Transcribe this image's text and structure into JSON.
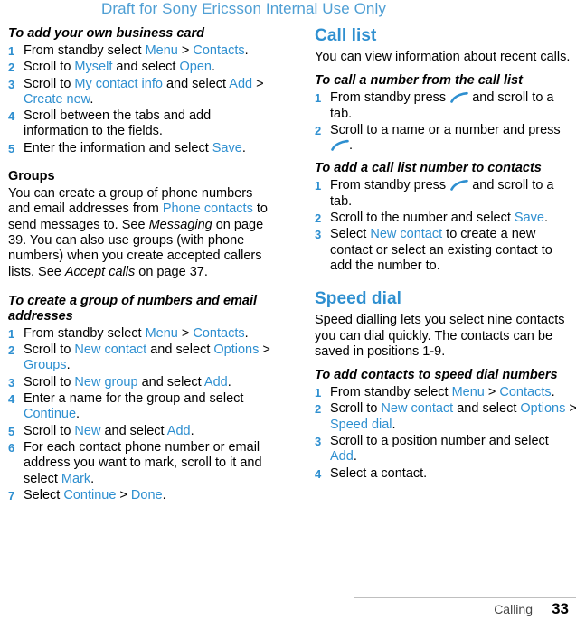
{
  "draft_notice": "Draft for Sony Ericsson Internal Use Only",
  "footer": {
    "chapter": "Calling",
    "page_number": "33"
  },
  "left_column": {
    "task1": {
      "heading": "To add your own business card",
      "steps": [
        {
          "parts": [
            {
              "t": "From standby select ",
              "s": "n"
            },
            {
              "t": "Menu",
              "s": "l"
            },
            {
              "t": " > ",
              "s": "n"
            },
            {
              "t": "Contacts",
              "s": "l"
            },
            {
              "t": ".",
              "s": "n"
            }
          ]
        },
        {
          "parts": [
            {
              "t": "Scroll to ",
              "s": "n"
            },
            {
              "t": "Myself",
              "s": "l"
            },
            {
              "t": " and select ",
              "s": "n"
            },
            {
              "t": "Open",
              "s": "l"
            },
            {
              "t": ".",
              "s": "n"
            }
          ]
        },
        {
          "parts": [
            {
              "t": "Scroll to ",
              "s": "n"
            },
            {
              "t": "My contact info",
              "s": "l"
            },
            {
              "t": " and select ",
              "s": "n"
            },
            {
              "t": "Add",
              "s": "l"
            },
            {
              "t": " > ",
              "s": "n"
            },
            {
              "t": "Create new",
              "s": "l"
            },
            {
              "t": ".",
              "s": "n"
            }
          ]
        },
        {
          "parts": [
            {
              "t": "Scroll between the tabs and add information to the fields.",
              "s": "n"
            }
          ]
        },
        {
          "parts": [
            {
              "t": "Enter the information and select ",
              "s": "n"
            },
            {
              "t": "Save",
              "s": "l"
            },
            {
              "t": ".",
              "s": "n"
            }
          ]
        }
      ]
    },
    "groups": {
      "heading": "Groups",
      "body": [
        {
          "parts": [
            {
              "t": "You can create a group of phone numbers and email addresses from ",
              "s": "n"
            },
            {
              "t": "Phone contacts",
              "s": "l"
            },
            {
              "t": " to send messages to. See ",
              "s": "n"
            },
            {
              "t": "Messaging",
              "s": "i"
            },
            {
              "t": " on page 39. You can also use groups (with phone numbers) when you create accepted callers lists. See ",
              "s": "n"
            },
            {
              "t": "Accept calls",
              "s": "i"
            },
            {
              "t": " on page 37.",
              "s": "n"
            }
          ]
        }
      ]
    },
    "task2": {
      "heading": "To create a group of numbers and email addresses",
      "steps": [
        {
          "parts": [
            {
              "t": "From standby select ",
              "s": "n"
            },
            {
              "t": "Menu",
              "s": "l"
            },
            {
              "t": " > ",
              "s": "n"
            },
            {
              "t": "Contacts",
              "s": "l"
            },
            {
              "t": ".",
              "s": "n"
            }
          ]
        },
        {
          "parts": [
            {
              "t": "Scroll to ",
              "s": "n"
            },
            {
              "t": "New contact",
              "s": "l"
            },
            {
              "t": " and select ",
              "s": "n"
            },
            {
              "t": "Options",
              "s": "l"
            },
            {
              "t": " > ",
              "s": "n"
            },
            {
              "t": "Groups",
              "s": "l"
            },
            {
              "t": ".",
              "s": "n"
            }
          ]
        },
        {
          "parts": [
            {
              "t": "Scroll to ",
              "s": "n"
            },
            {
              "t": "New group",
              "s": "l"
            },
            {
              "t": " and select ",
              "s": "n"
            },
            {
              "t": "Add",
              "s": "l"
            },
            {
              "t": ".",
              "s": "n"
            }
          ]
        },
        {
          "parts": [
            {
              "t": "Enter a name for the group and select ",
              "s": "n"
            },
            {
              "t": "Continue",
              "s": "l"
            },
            {
              "t": ".",
              "s": "n"
            }
          ]
        },
        {
          "parts": [
            {
              "t": "Scroll to ",
              "s": "n"
            },
            {
              "t": "New",
              "s": "l"
            },
            {
              "t": " and select ",
              "s": "n"
            },
            {
              "t": "Add",
              "s": "l"
            },
            {
              "t": ".",
              "s": "n"
            }
          ]
        },
        {
          "parts": [
            {
              "t": "For each contact phone number or email address you want to mark, scroll to it and select ",
              "s": "n"
            },
            {
              "t": "Mark",
              "s": "l"
            },
            {
              "t": ".",
              "s": "n"
            }
          ]
        },
        {
          "parts": [
            {
              "t": "Select ",
              "s": "n"
            },
            {
              "t": "Continue",
              "s": "l"
            },
            {
              "t": " > ",
              "s": "n"
            },
            {
              "t": "Done",
              "s": "l"
            },
            {
              "t": ".",
              "s": "n"
            }
          ]
        }
      ]
    }
  },
  "right_column": {
    "call_list": {
      "heading": "Call list",
      "intro": "You can view information about recent calls.",
      "task1": {
        "heading": "To call a number from the call list",
        "steps": [
          {
            "parts": [
              {
                "t": "From standby press ",
                "s": "n"
              },
              {
                "t": "",
                "s": "phone"
              },
              {
                "t": " and scroll to a tab.",
                "s": "n"
              }
            ]
          },
          {
            "parts": [
              {
                "t": "Scroll to a name or a number and press ",
                "s": "n"
              },
              {
                "t": "",
                "s": "phone"
              },
              {
                "t": ".",
                "s": "n"
              }
            ]
          }
        ]
      },
      "task2": {
        "heading": "To add a call list number to contacts",
        "steps": [
          {
            "parts": [
              {
                "t": "From standby press ",
                "s": "n"
              },
              {
                "t": "",
                "s": "phone"
              },
              {
                "t": " and scroll to a tab.",
                "s": "n"
              }
            ]
          },
          {
            "parts": [
              {
                "t": "Scroll to the number and select ",
                "s": "n"
              },
              {
                "t": "Save",
                "s": "l"
              },
              {
                "t": ".",
                "s": "n"
              }
            ]
          },
          {
            "parts": [
              {
                "t": "Select ",
                "s": "n"
              },
              {
                "t": "New contact",
                "s": "l"
              },
              {
                "t": " to create a new contact or select an existing contact to add the number to.",
                "s": "n"
              }
            ]
          }
        ]
      }
    },
    "speed_dial": {
      "heading": "Speed dial",
      "intro": "Speed dialling lets you select nine contacts you can dial quickly. The contacts can be saved in positions 1-9.",
      "task1": {
        "heading": "To add contacts to speed dial numbers",
        "steps": [
          {
            "parts": [
              {
                "t": "From standby select ",
                "s": "n"
              },
              {
                "t": "Menu",
                "s": "l"
              },
              {
                "t": " > ",
                "s": "n"
              },
              {
                "t": "Contacts",
                "s": "l"
              },
              {
                "t": ".",
                "s": "n"
              }
            ]
          },
          {
            "parts": [
              {
                "t": "Scroll to ",
                "s": "n"
              },
              {
                "t": "New contact",
                "s": "l"
              },
              {
                "t": " and select ",
                "s": "n"
              },
              {
                "t": "Options",
                "s": "l"
              },
              {
                "t": " > ",
                "s": "n"
              },
              {
                "t": "Speed dial",
                "s": "l"
              },
              {
                "t": ".",
                "s": "n"
              }
            ]
          },
          {
            "parts": [
              {
                "t": "Scroll to a position number and select ",
                "s": "n"
              },
              {
                "t": "Add",
                "s": "l"
              },
              {
                "t": ".",
                "s": "n"
              }
            ]
          },
          {
            "parts": [
              {
                "t": "Select a contact.",
                "s": "n"
              }
            ]
          }
        ]
      }
    }
  },
  "colors": {
    "link": "#2e8fd0",
    "draft": "#4f9fd4"
  }
}
